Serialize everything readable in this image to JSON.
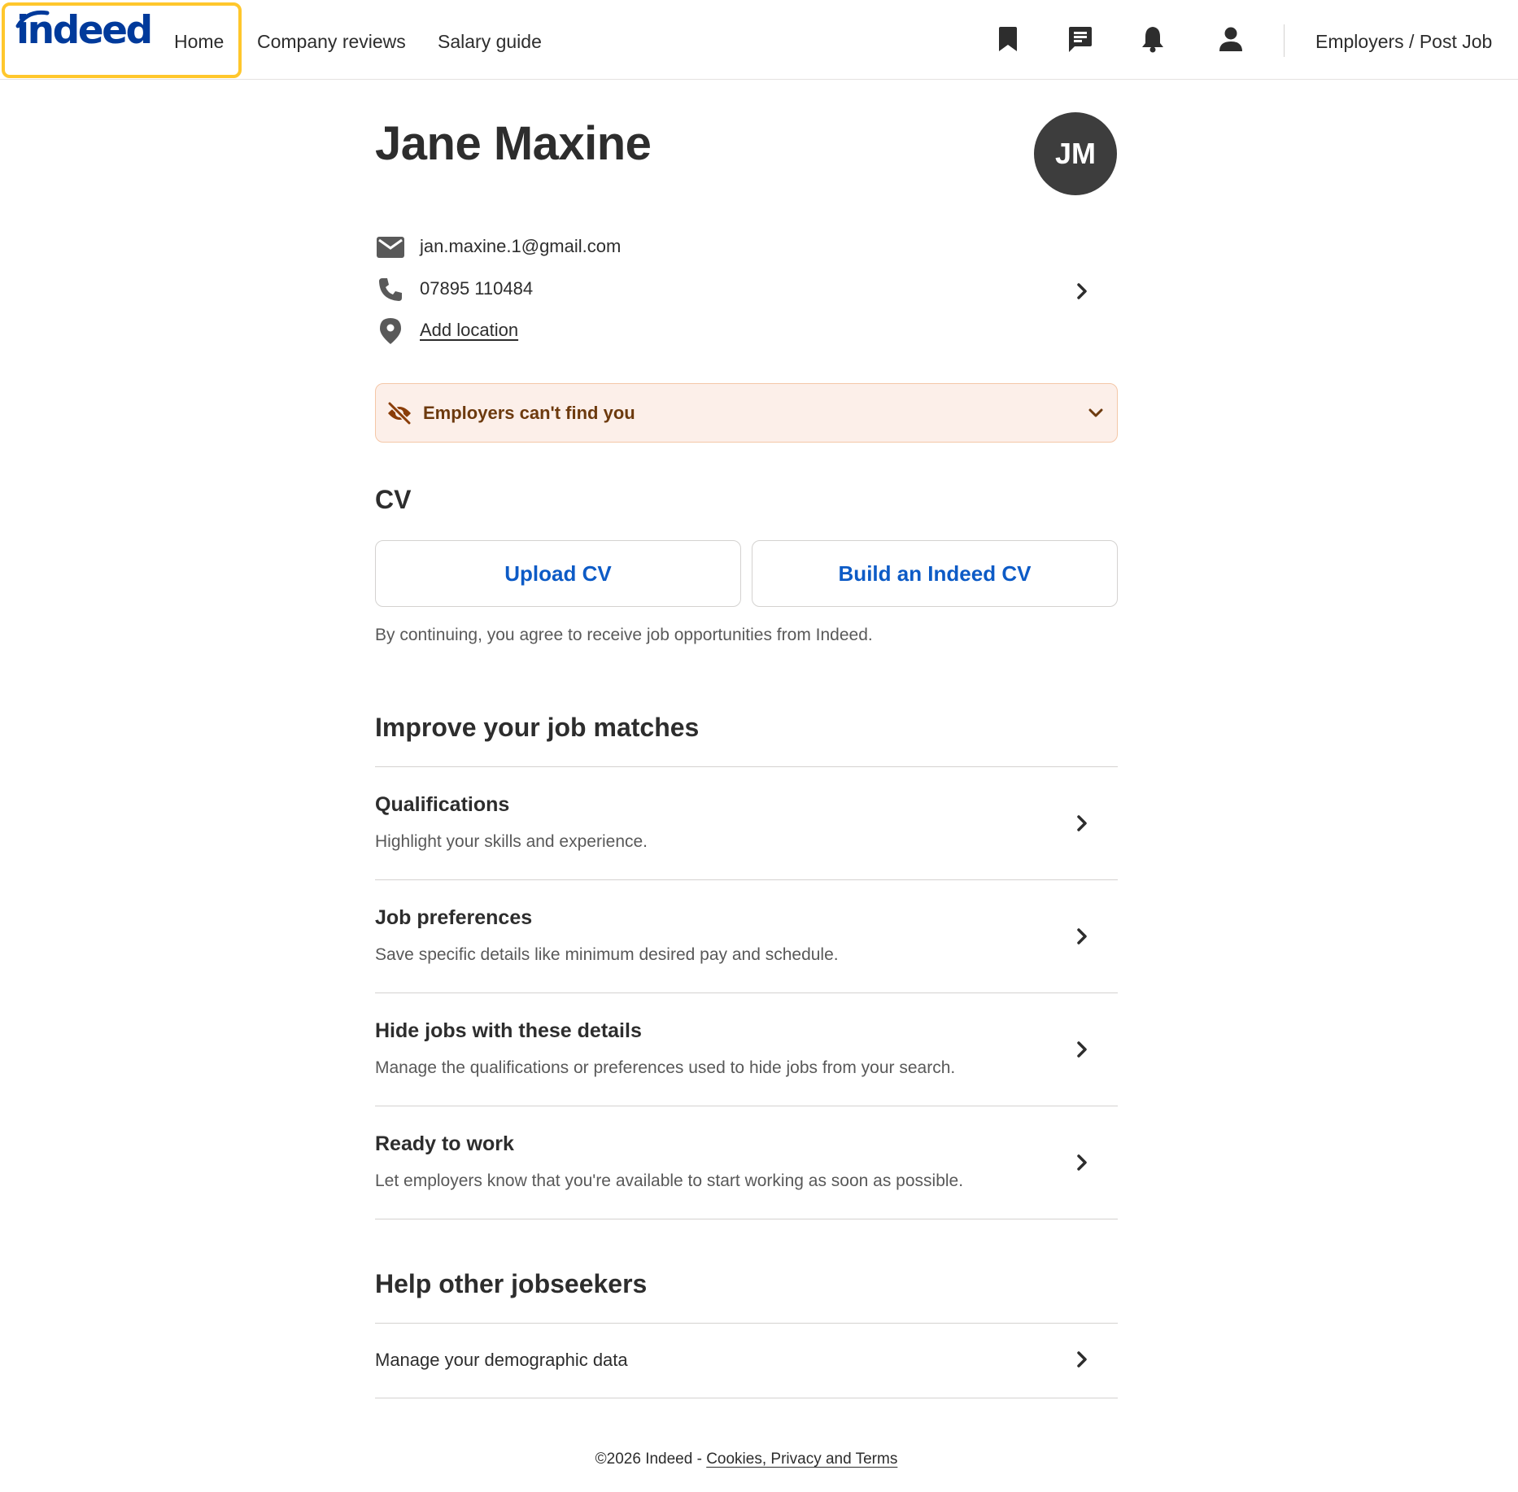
{
  "header": {
    "logo_text": "indeed",
    "nav": {
      "home": "Home",
      "company_reviews": "Company reviews",
      "salary_guide": "Salary guide"
    },
    "icons": [
      "bookmark-icon",
      "messages-icon",
      "bell-icon",
      "person-icon"
    ],
    "employers_link": "Employers / Post Job",
    "brand_color": "#003a9b",
    "focus_ring_color": "#ffc72c"
  },
  "profile": {
    "name": "Jane Maxine",
    "initials": "JM",
    "email": "jan.maxine.1@gmail.com",
    "phone": "07895 110484",
    "location_link": "Add location"
  },
  "visibility_banner": {
    "text": "Employers can't find you",
    "icon": "eye-off-icon",
    "background": "#fcefe9",
    "text_color": "#6d3a0e"
  },
  "cv": {
    "title": "CV",
    "upload_label": "Upload CV",
    "build_label": "Build an Indeed CV",
    "note": "By continuing, you agree to receive job opportunities from Indeed.",
    "accent": "#0d5bc6"
  },
  "job_matches": {
    "title": "Improve your job matches",
    "items": [
      {
        "title": "Qualifications",
        "description": "Highlight your skills and experience."
      },
      {
        "title": "Job preferences",
        "description": "Save specific details like minimum desired pay and schedule."
      },
      {
        "title": "Hide jobs with these details",
        "description": "Manage the qualifications or preferences used to hide jobs from your search."
      },
      {
        "title": "Ready to work",
        "description": "Let employers know that you're available to start working as soon as possible."
      }
    ]
  },
  "help": {
    "title": "Help other jobseekers",
    "demographic_link": "Manage your demographic data"
  },
  "footer": {
    "copyright": "©2026 Indeed - ",
    "link": "Cookies, Privacy and Terms"
  }
}
